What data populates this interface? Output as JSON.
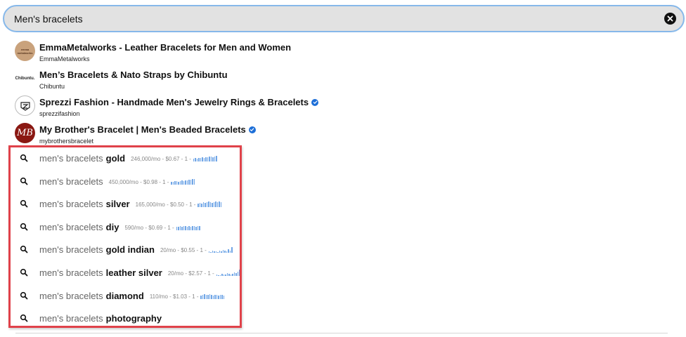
{
  "search": {
    "value": "Men's bracelets",
    "clear_icon": "close-circle-icon"
  },
  "shops": [
    {
      "title": "EmmaMetalworks - Leather Bracelets for Men and Women",
      "handle": "EmmaMetalworks",
      "verified": false,
      "avatar": "emma-metalworks-logo",
      "avatar_text": "emma metalworks"
    },
    {
      "title": "Men’s Bracelets & Nato Straps by Chibuntu",
      "handle": "Chibuntu",
      "verified": false,
      "avatar": "chibuntu-logo",
      "avatar_text": "Chibuntu."
    },
    {
      "title": "Sprezzi Fashion - Handmade Men's Jewelry Rings & Bracelets",
      "handle": "sprezzifashion",
      "verified": true,
      "avatar": "sprezzi-logo",
      "avatar_text": ""
    },
    {
      "title": "My Brother's Bracelet | Men's Beaded Bracelets",
      "handle": "mybrothersbracelet",
      "verified": true,
      "avatar": "mybrothersbracelet-logo",
      "avatar_text": "MB"
    }
  ],
  "suggestions": [
    {
      "base": "men's bracelets",
      "bold": "gold",
      "meta": "246,000/mo - $0.67 - 1 -",
      "trend": [
        4,
        5,
        4,
        5,
        5,
        6,
        5,
        6,
        6,
        7,
        7,
        6,
        7,
        8
      ]
    },
    {
      "base": "men's bracelets",
      "bold": "",
      "meta": "450,000/mo - $0.98 - 1 -",
      "trend": [
        4,
        4,
        5,
        5,
        4,
        5,
        6,
        5,
        6,
        6,
        7,
        7,
        8,
        8
      ]
    },
    {
      "base": "men's bracelets",
      "bold": "silver",
      "meta": "165,000/mo - $0.50 - 1 -",
      "trend": [
        5,
        6,
        5,
        7,
        6,
        7,
        8,
        7,
        6,
        7,
        8,
        7,
        8,
        7
      ]
    },
    {
      "base": "men's bracelets",
      "bold": "diy",
      "meta": "590/mo - $0.69 - 1 -",
      "trend": [
        5,
        5,
        6,
        5,
        6,
        6,
        5,
        6,
        5,
        6,
        6,
        5,
        6,
        6
      ]
    },
    {
      "base": "men's bracelets",
      "bold": "gold indian",
      "meta": "20/mo - $0.55 - 1 -",
      "trend": [
        2,
        1,
        3,
        2,
        2,
        1,
        3,
        2,
        4,
        3,
        2,
        5,
        3,
        8
      ]
    },
    {
      "base": "men's bracelets",
      "bold": "leather silver",
      "meta": "20/mo - $2.57 - 1 -",
      "trend": [
        2,
        1,
        1,
        3,
        2,
        2,
        4,
        3,
        2,
        3,
        5,
        4,
        6,
        9
      ]
    },
    {
      "base": "men's bracelets",
      "bold": "diamond",
      "meta": "110/mo - $1.03 - 1 -",
      "trend": [
        5,
        6,
        7,
        6,
        6,
        7,
        6,
        5,
        6,
        6,
        5,
        6,
        6,
        5
      ]
    },
    {
      "base": "men's bracelets",
      "bold": "photography",
      "meta": "",
      "trend": []
    }
  ],
  "icons": {
    "search": "search-icon",
    "verified": "verified-badge-icon"
  },
  "colors": {
    "accent_border": "#86b8ea",
    "highlight": "#e0424a",
    "verified": "#1d6fd8",
    "spark": "#6fa5e6"
  }
}
